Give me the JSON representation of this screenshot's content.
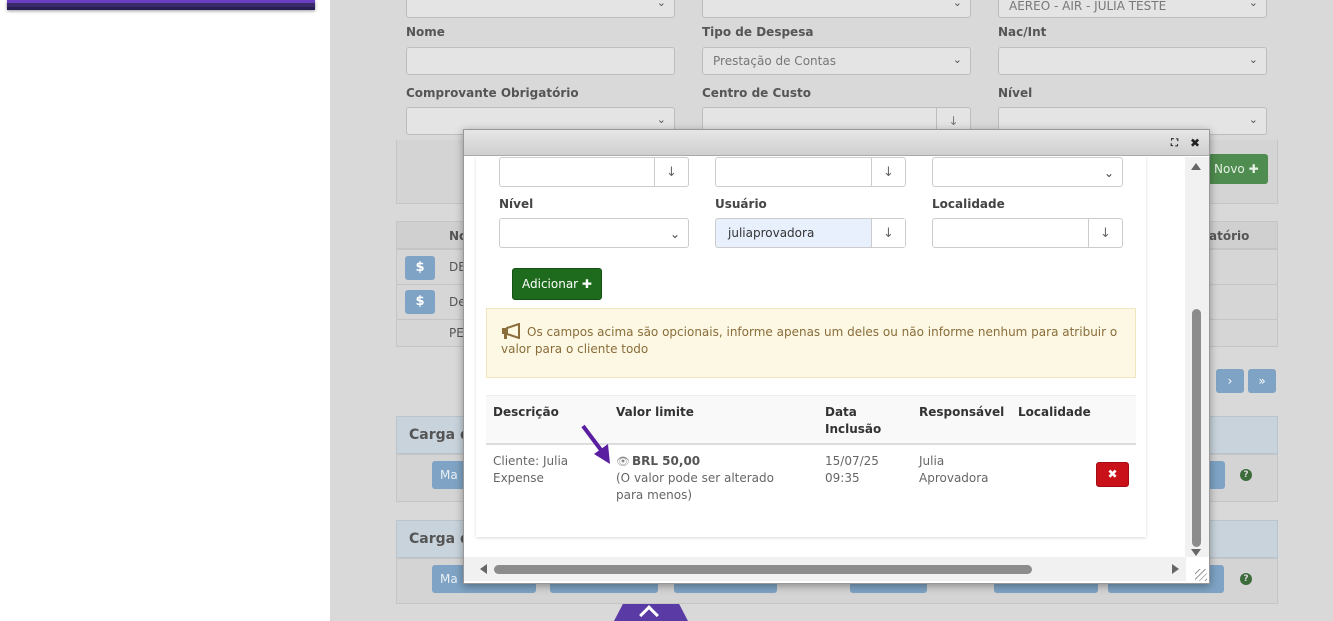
{
  "background": {
    "top_selects": [
      "",
      "",
      "AEREO - AIR - JULIA TESTE"
    ],
    "labels": {
      "nome": "Nome",
      "tipo_despesa": "Tipo de Despesa",
      "nac_int": "Nac/Int",
      "comprovante": "Comprovante Obrigatório",
      "centro_custo": "Centro de Custo",
      "nivel": "Nível"
    },
    "tipo_despesa_value": "Prestação de Contas",
    "novo_button": "Novo ✚",
    "table": {
      "col_nome": "No",
      "col_obrigatorio": "atório",
      "rows": [
        "DE",
        "De",
        "PE"
      ]
    },
    "pager": [
      "›",
      "»"
    ],
    "panels": [
      "Carga d",
      "Carga d"
    ],
    "panel_button": "Ma"
  },
  "modal": {
    "titlebar_icons": [
      "expand-icon",
      "close-icon"
    ],
    "fields": {
      "nivel_label": "Nível",
      "usuario_label": "Usuário",
      "usuario_value": "juliaprovadora",
      "localidade_label": "Localidade"
    },
    "add_button": "Adicionar ✚",
    "alert_text": "Os campos acima são opcionais, informe apenas um deles ou não informe nenhum para atribuir o valor para o cliente todo",
    "table": {
      "headers": [
        "Descrição",
        "Valor limite",
        "Data Inclusão",
        "Responsável",
        "Localidade"
      ],
      "rows": [
        {
          "descricao": "Cliente: Julia Expense",
          "valor": "BRL 50,00",
          "valor_note": "(O valor pode ser alterado para menos)",
          "data": "15/07/25 09:35",
          "responsavel": "Julia Aprovadora",
          "localidade": ""
        }
      ]
    },
    "delete_icon": "✖"
  },
  "colors": {
    "accent_purple": "#5a3aa4",
    "success_green": "#1e6b1e",
    "danger_red": "#c9111a",
    "alert_bg": "#fcf8e3"
  }
}
